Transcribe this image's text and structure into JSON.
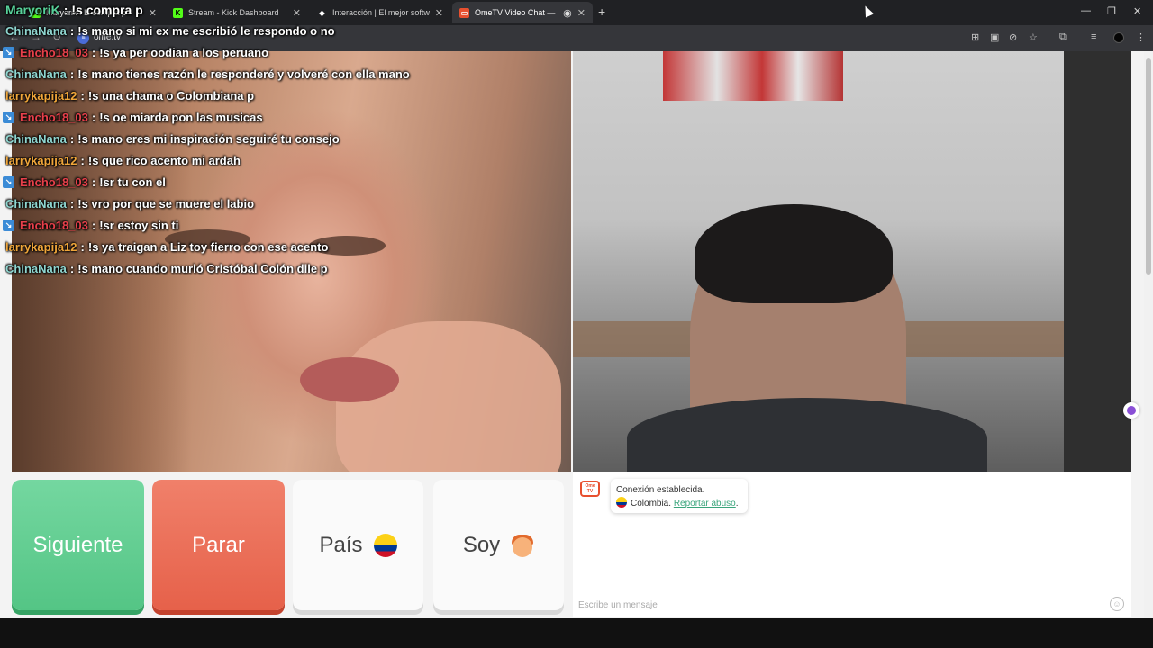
{
  "browser": {
    "tabs": [
      {
        "label": "Maryorik : !s compra p",
        "icon": "kick-icon",
        "active": false
      },
      {
        "label": "Stream - Kick Dashboard",
        "icon": "kick-icon",
        "active": false
      },
      {
        "label": "Interacción | El mejor software",
        "icon": "diamond-icon",
        "active": false
      },
      {
        "label": "OmeTV Video Chat — Ome",
        "icon": "ometv-icon",
        "active": true
      }
    ],
    "url": "ome.tv"
  },
  "chat_overlay": {
    "top_line": {
      "user": "MaryoriK",
      "message": "!s compra p",
      "user_color": "#58d19a"
    },
    "messages": [
      {
        "user": "ChinaNana",
        "message": "!s mano si mi ex me escribió le respondo o no",
        "user_color": "#8fd6d0",
        "badge": false
      },
      {
        "user": "Encho18_03",
        "message": "!s ya per oodian a los peruano",
        "user_color": "#e8404b",
        "badge": true
      },
      {
        "user": "ChinaNana",
        "message": "!s mano tienes razón le responderé y volveré con ella mano",
        "user_color": "#8fd6d0",
        "badge": false
      },
      {
        "user": "larrykapija12",
        "message": "!s una chama o Colombiana p",
        "user_color": "#f0a63a",
        "badge": false
      },
      {
        "user": "Encho18_03",
        "message": "!s oe miarda pon las musicas",
        "user_color": "#e8404b",
        "badge": true
      },
      {
        "user": "ChinaNana",
        "message": "!s mano eres mi inspiración seguiré tu consejo",
        "user_color": "#8fd6d0",
        "badge": false
      },
      {
        "user": "larrykapija12",
        "message": "!s que rico acento mi ardah",
        "user_color": "#f0a63a",
        "badge": false
      },
      {
        "user": "Encho18_03",
        "message": "!sr tu con el",
        "user_color": "#e8404b",
        "badge": true
      },
      {
        "user": "ChinaNana",
        "message": "!s vro por que se muere el labio",
        "user_color": "#8fd6d0",
        "badge": false
      },
      {
        "user": "Encho18_03",
        "message": "!sr estoy sin ti",
        "user_color": "#e8404b",
        "badge": true
      },
      {
        "user": "larrykapija12",
        "message": "!s ya traigan a Liz toy fierro con ese acento",
        "user_color": "#f0a63a",
        "badge": false
      },
      {
        "user": "ChinaNana",
        "message": "!s mano cuando murió Cristóbal Colón dile p",
        "user_color": "#8fd6d0",
        "badge": false
      }
    ]
  },
  "controls": {
    "next_label": "Siguiente",
    "stop_label": "Parar",
    "country_label": "País",
    "country_flag": "colombia-flag-icon",
    "gender_label": "Soy",
    "gender_icon": "boy-icon"
  },
  "chat_panel": {
    "logo_text": "Ome TV",
    "status": "Conexión establecida.",
    "country": "Colombia.",
    "report_link": "Reportar abuso",
    "report_suffix": ".",
    "input_placeholder": "Escribe un mensaje"
  },
  "colors": {
    "next": "#5ccb8c",
    "stop": "#ea6a52",
    "link": "#3aa57c"
  }
}
